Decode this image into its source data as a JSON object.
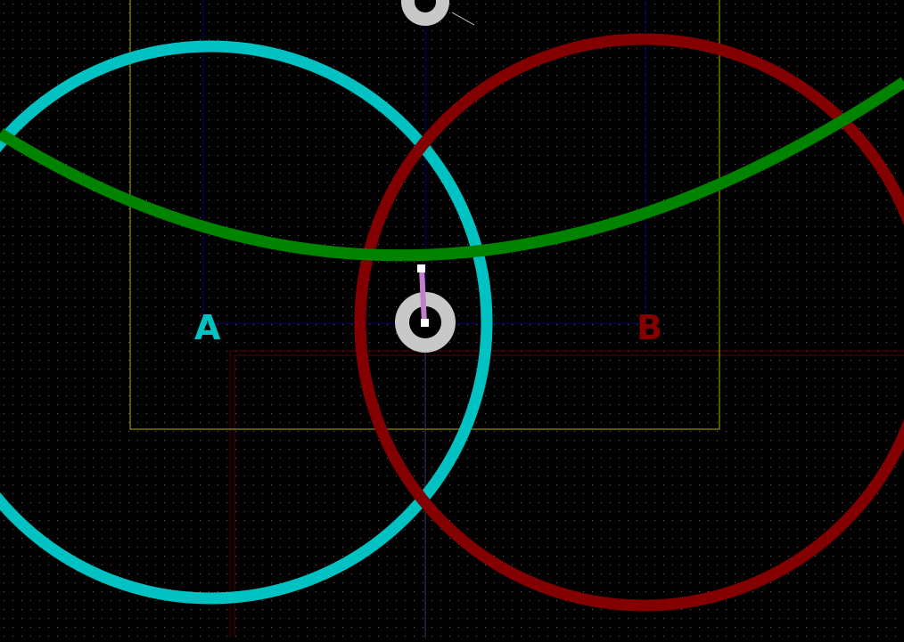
{
  "canvas": {
    "background": "#000000",
    "grid_color": "#5a5a5a"
  },
  "labels": {
    "a": "A",
    "b": "B"
  },
  "colors": {
    "circle_a": "#00c2c2",
    "circle_b": "#840000",
    "arc": "#008400",
    "pad": "#c8c8c8",
    "segment": "#c080c8",
    "handle": "#ffffff",
    "guide": "#00007a",
    "outline": "#b0b000",
    "board_edge": "#5a0000"
  },
  "icons": {
    "pad_center": "via-pad-icon",
    "pad_top": "via-pad-icon",
    "endpoint": "drag-handle-icon"
  }
}
